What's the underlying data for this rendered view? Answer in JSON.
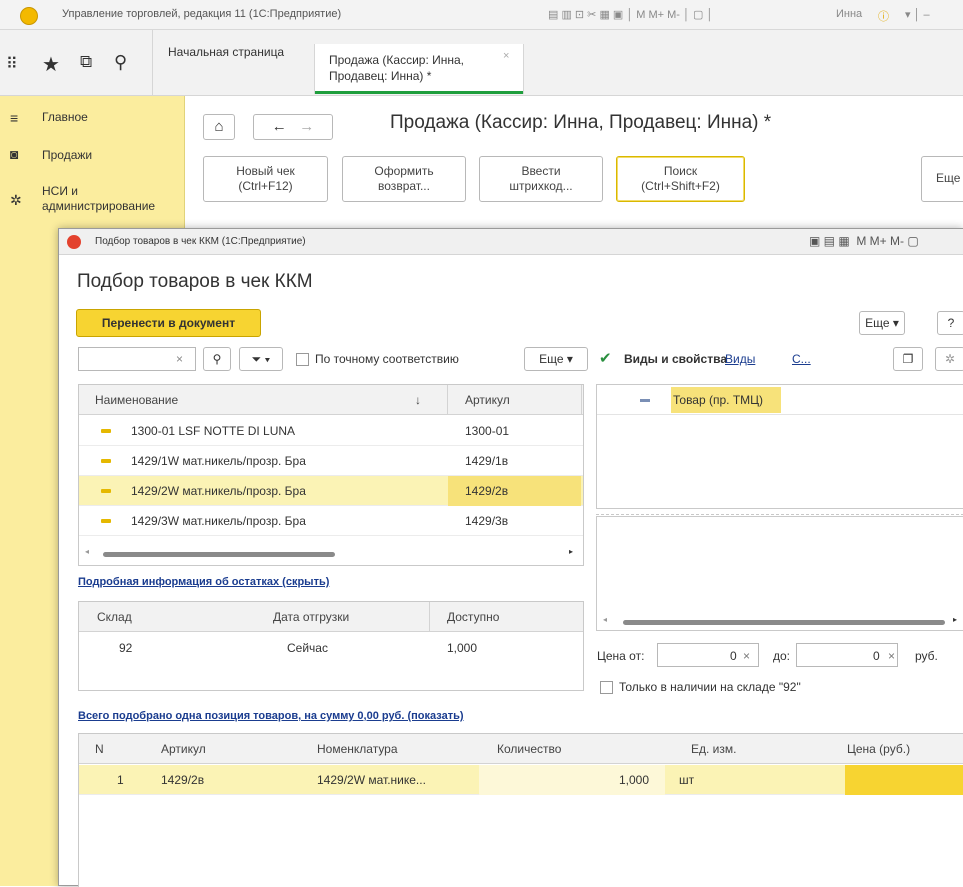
{
  "app": {
    "title": "Управление торговлей, редакция 11  (1С:Предприятие)",
    "user": "Инна"
  },
  "tabs": {
    "home": "Начальная страница",
    "active_line1": "Продажа (Кассир: Инна,",
    "active_line2": "Продавец: Инна) *"
  },
  "sidebar": {
    "items": [
      {
        "label": "Главное",
        "icon": "menu-icon"
      },
      {
        "label": "Продажи",
        "icon": "bag-icon"
      },
      {
        "label": "НСИ и",
        "label2": "администрирование",
        "icon": "gear-icon"
      }
    ]
  },
  "form": {
    "title": "Продажа (Кассир: Инна, Продавец: Инна) *",
    "buttons": [
      {
        "l1": "Новый чек",
        "l2": "(Ctrl+F12)"
      },
      {
        "l1": "Оформить",
        "l2": "возврат..."
      },
      {
        "l1": "Ввести",
        "l2": "штрихкод..."
      },
      {
        "l1": "Поиск",
        "l2": "(Ctrl+Shift+F2)"
      }
    ],
    "more": "Еще"
  },
  "dialog": {
    "window_title": "Подбор товаров в чек ККМ (1С:Предприятие)",
    "heading": "Подбор товаров в чек ККМ",
    "transfer_button": "Перенести в документ",
    "more": "Еще",
    "help": "?",
    "exact_match": "По точному соответствию",
    "kinds_label": "Виды и свойства",
    "kinds_link1": "Виды",
    "kinds_link2": "С...",
    "search_value": "",
    "goods": {
      "headers": [
        "Наименование",
        "Артикул"
      ],
      "rows": [
        {
          "name": "1300-01 LSF NOTTE DI LUNA",
          "sku": "1300-01"
        },
        {
          "name": "1429/1W мат.никель/прозр. Бра",
          "sku": "1429/1в"
        },
        {
          "name": "1429/2W мат.никель/прозр. Бра",
          "sku": "1429/2в"
        },
        {
          "name": "1429/3W мат.никель/прозр. Бра",
          "sku": "1429/3в"
        }
      ],
      "sort_indicator": "↓"
    },
    "tree_item": "Товар (пр. ТМЦ)",
    "stock_link": "Подробная информация об остатках (скрыть)",
    "stock": {
      "headers": [
        "Склад",
        "Дата отгрузки",
        "Доступно"
      ],
      "rows": [
        {
          "warehouse": "92",
          "date": "Сейчас",
          "available": "1,000"
        }
      ]
    },
    "price_from_label": "Цена от:",
    "price_from": "0",
    "price_to_label": "до:",
    "price_to": "0",
    "currency": "руб.",
    "in_stock_label": "Только в наличии на складе \"92\"",
    "summary_link": "Всего подобрано одна позиция товаров, на сумму 0,00 руб. (показать)",
    "selected": {
      "headers": [
        "N",
        "Артикул",
        "Номенклатура",
        "Количество",
        "Ед. изм.",
        "Цена (руб.)"
      ],
      "rows": [
        {
          "n": "1",
          "sku": "1429/2в",
          "name": "1429/2W мат.нике...",
          "qty": "1,000",
          "unit": "шт",
          "price": ""
        }
      ]
    }
  },
  "colors": {
    "accent_yellow": "#f7d431",
    "sidebar_bg": "#fbed9e",
    "selected_row": "#fbf3b5",
    "active_tab_line": "#1f9e3d"
  }
}
